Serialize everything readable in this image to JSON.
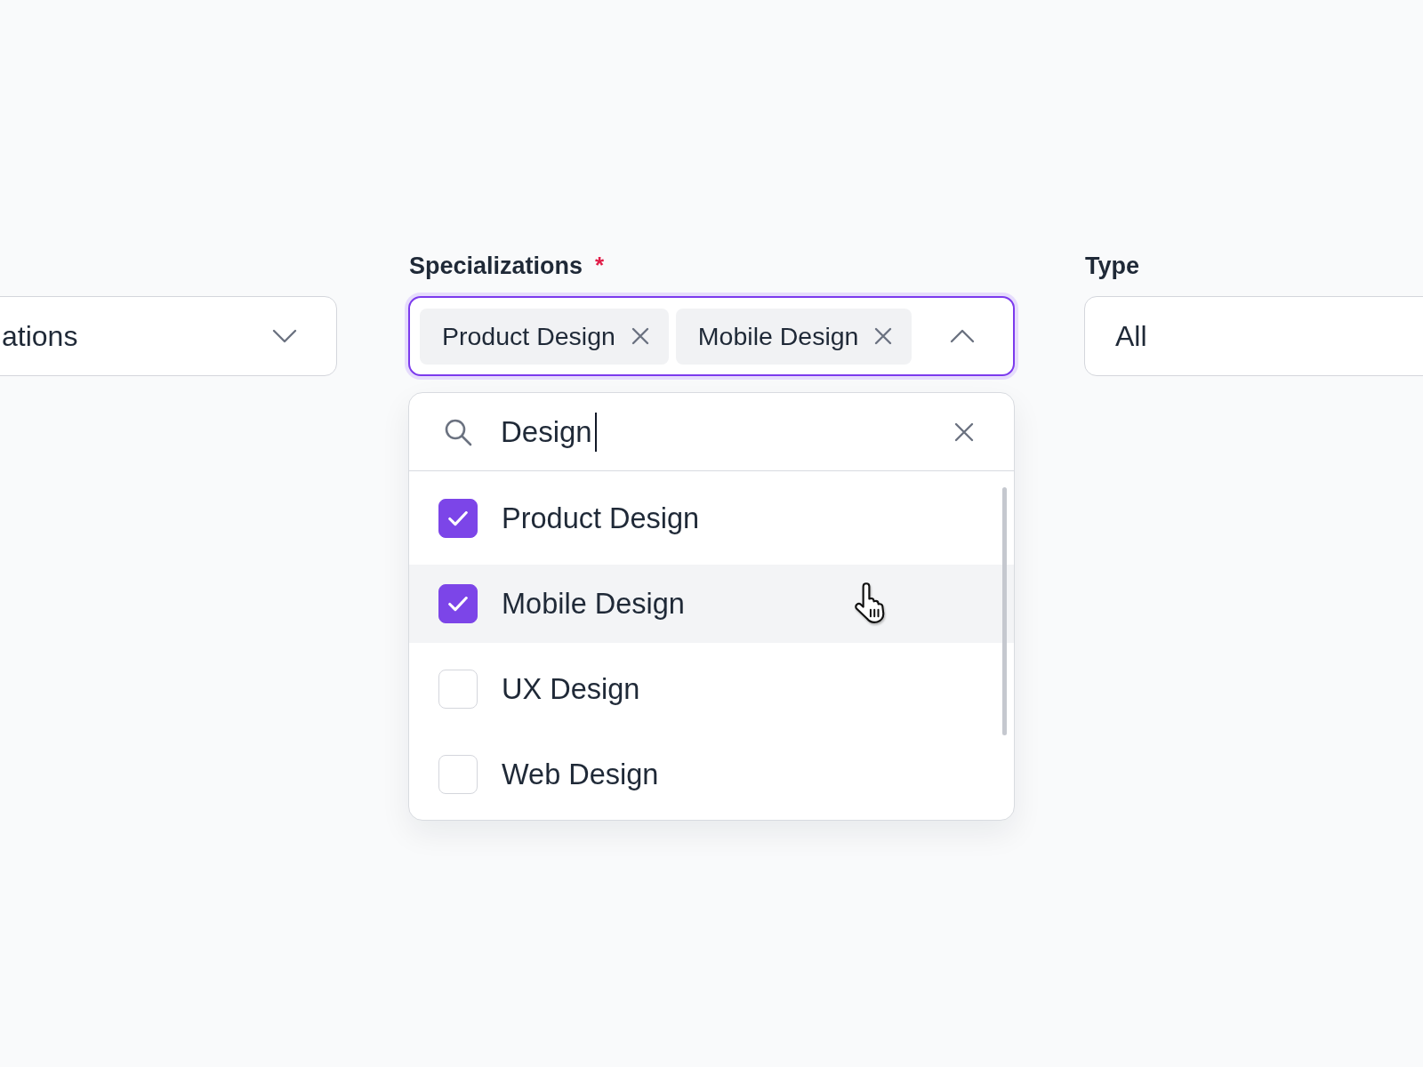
{
  "filters": [
    {
      "kind": "select",
      "value": "ations",
      "expanded": false
    },
    {
      "kind": "multiselect",
      "label": "Specializations",
      "required_mark": "*",
      "focused": true,
      "expanded": true,
      "chips": [
        {
          "label": "Product Design"
        },
        {
          "label": "Mobile Design"
        }
      ],
      "search": {
        "value": "Design",
        "focused": true
      },
      "options": [
        {
          "label": "Product Design",
          "checked": true,
          "hovered": false
        },
        {
          "label": "Mobile Design",
          "checked": true,
          "hovered": true
        },
        {
          "label": "UX Design",
          "checked": false,
          "hovered": false
        },
        {
          "label": "Web Design",
          "checked": false,
          "hovered": false
        }
      ]
    },
    {
      "kind": "select",
      "label": "Type",
      "value": "All"
    }
  ]
}
